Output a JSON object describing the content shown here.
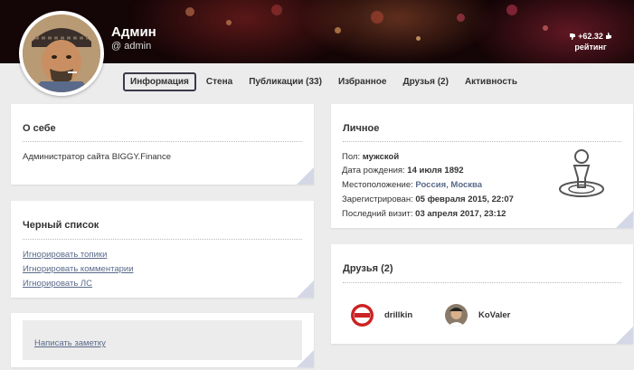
{
  "header": {
    "name": "Админ",
    "login": "@ admin",
    "rating_value": "+62.32",
    "rating_label": "рейтинг"
  },
  "tabs": [
    {
      "label": "Информация",
      "active": true
    },
    {
      "label": "Стена"
    },
    {
      "label": "Публикации (33)"
    },
    {
      "label": "Избранное"
    },
    {
      "label": "Друзья (2)"
    },
    {
      "label": "Активность"
    }
  ],
  "about": {
    "title": "О себе",
    "text": "Администратор сайта BIGGY.Finance"
  },
  "blacklist": {
    "title": "Черный список",
    "links": [
      "Игнорировать топики",
      "Игнорировать комментарии",
      "Игнорировать ЛС"
    ]
  },
  "note": {
    "label": "Написать заметку"
  },
  "personal": {
    "title": "Личное",
    "gender_label": "Пол:",
    "gender": "мужской",
    "birth_label": "Дата рождения:",
    "birth": "14 июля 1892",
    "location_label": "Местоположение:",
    "country": "Россия",
    "separator": ",",
    "city": "Москва",
    "registered_label": "Зарегистрирован:",
    "registered": "05 февраля 2015, 22:07",
    "last_visit_label": "Последний визит:",
    "last_visit": "03 апреля 2017, 23:12"
  },
  "friends": {
    "title": "Друзья (2)",
    "items": [
      {
        "name": "drillkin"
      },
      {
        "name": "KoValer"
      }
    ]
  },
  "colors": {
    "banner": "#140506",
    "background": "#ececec",
    "link": "#5a6a8a",
    "corner": "#d4d8e6"
  }
}
